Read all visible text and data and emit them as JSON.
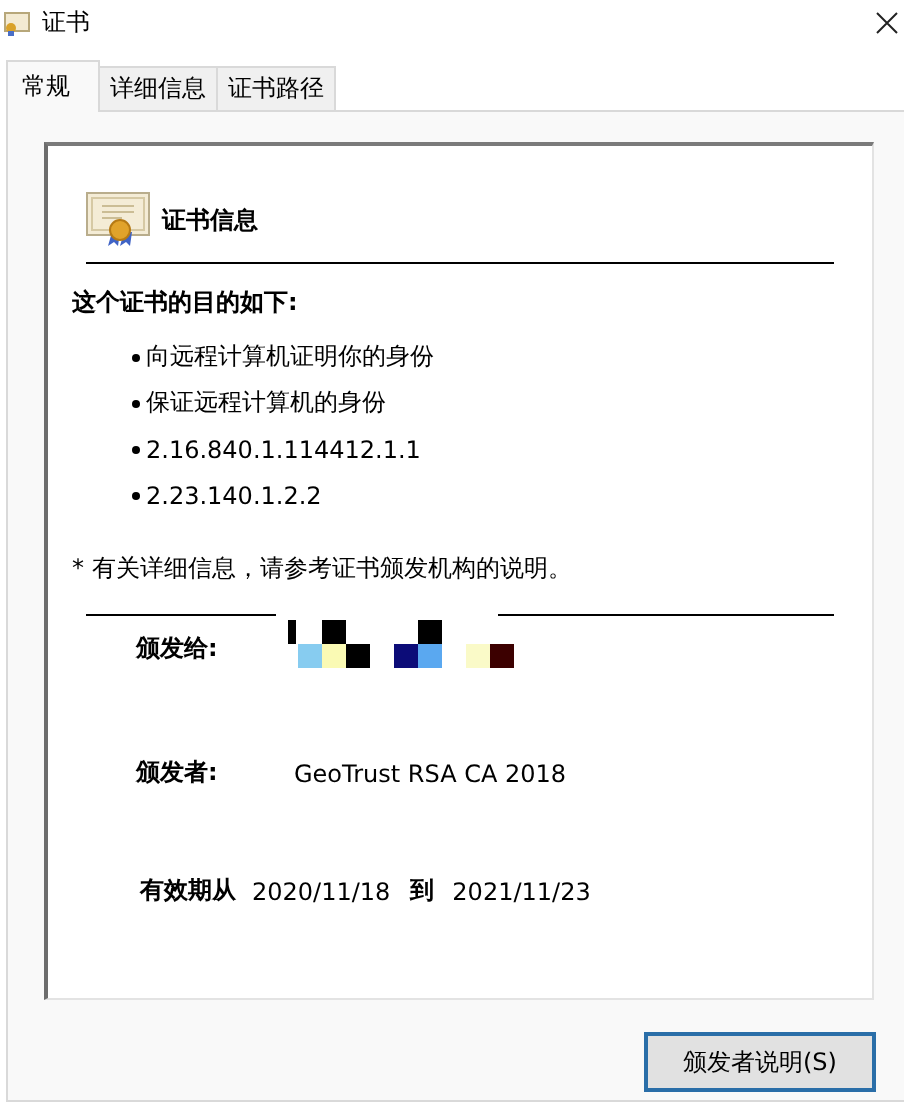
{
  "window": {
    "title": "证书"
  },
  "tabs": [
    {
      "label": "常规",
      "selected": true
    },
    {
      "label": "详细信息",
      "selected": false
    },
    {
      "label": "证书路径",
      "selected": false
    }
  ],
  "cert_info": {
    "heading": "证书信息",
    "purposes_title": "这个证书的目的如下:",
    "purposes": [
      "向远程计算机证明你的身份",
      "保证远程计算机的身份",
      "2.16.840.1.114412.1.1",
      "2.23.140.1.2.2"
    ],
    "note": "* 有关详细信息，请参考证书颁发机构的说明。",
    "issued_to": {
      "label": "颁发给:",
      "redacted": true
    },
    "issued_by": {
      "label": "颁发者:",
      "value": "GeoTrust RSA CA 2018"
    },
    "validity": {
      "label": "有效期从",
      "from": "2020/11/18",
      "to_label": "到",
      "to": "2021/11/23"
    }
  },
  "buttons": [
    {
      "label": "颁发者说明(S)"
    }
  ]
}
